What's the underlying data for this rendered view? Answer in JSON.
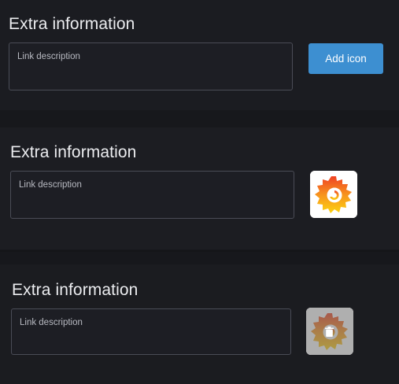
{
  "sections": [
    {
      "title": "Extra information",
      "description_placeholder": "Link description",
      "action": {
        "type": "button",
        "label": "Add icon"
      }
    },
    {
      "title": "Extra information",
      "description_placeholder": "Link description",
      "action": {
        "type": "icon",
        "icon": "grafana-logo-icon"
      }
    },
    {
      "title": "Extra information",
      "description_placeholder": "Link description",
      "action": {
        "type": "icon-hover",
        "icon": "grafana-logo-icon",
        "overlay_icon": "trash-icon"
      }
    }
  ],
  "colors": {
    "background": "#1a1b1f",
    "accent": "#3d8fd1",
    "text": "#ebecef",
    "placeholder": "#b8bac2"
  }
}
